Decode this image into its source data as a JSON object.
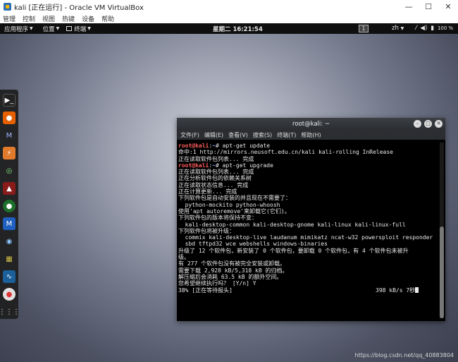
{
  "vbox": {
    "title": "kali [正在运行] - Oracle VM VirtualBox",
    "menu": [
      "管理",
      "控制",
      "视图",
      "热键",
      "设备",
      "帮助"
    ],
    "controls": {
      "minimize": "—",
      "maximize": "☐",
      "close": "✕"
    }
  },
  "topbar": {
    "apps": "应用程序",
    "places": "位置",
    "terminal": "终端",
    "clock": "星期二 16:21:54",
    "workspace": "1",
    "lang": "zh",
    "battery": "100 %"
  },
  "dock": {
    "icons": [
      "terminal-icon",
      "firefox-icon",
      "metasploit-icon",
      "burpsuite-icon",
      "maltego-icon",
      "armitage-icon",
      "faraday-icon",
      "maltego-m-icon",
      "eye-icon",
      "cherrytree-icon",
      "wireshark-icon",
      "chromium-icon",
      "app-grid-icon"
    ]
  },
  "terminal": {
    "title": "root@kali: ~",
    "menu": [
      "文件(F)",
      "编辑(E)",
      "查看(V)",
      "搜索(S)",
      "终端(T)",
      "帮助(H)"
    ],
    "prompt_user": "root@kali",
    "prompt_sep": ":",
    "prompt_path": "~",
    "prompt_hash": "# ",
    "cmd1": "apt-get update",
    "cmd2": "apt-get upgrade",
    "lines_a": [
      "命中:1 http://mirrors.neusoft.edu.cn/kali kali-rolling InRelease",
      "正在读取软件包列表... 完成"
    ],
    "lines_b": [
      "正在读取软件包列表... 完成",
      "正在分析软件包的依赖关系树",
      "正在读取状态信息... 完成",
      "正在计算更新... 完成",
      "下列软件包是自动安装的并且现在不需要了：",
      "  python-mockito python-whoosh",
      "使用'apt autoremove'来卸载它(它们)。",
      "下列软件包的版本将保持不变：",
      "  kali-desktop-common kali-desktop-gnome kali-linux kali-linux-full",
      "下列软件包将被升级：",
      "  commix kali-desktop-live laudanum mimikatz ncat-w32 powersploit responder",
      "  sbd tftpd32 wce webshells windows-binaries",
      "升级了 12 个软件包，新安装了 0 个软件包，要卸载 0 个软件包，有 4 个软件包未被升",
      "级。",
      "有 277 个软件包没有被完全安装或卸载。",
      "需要下载 2,928 kB/5,318 kB 的归档。",
      "解压缩后会消耗 63.5 kB 的额外空间。",
      "您希望继续执行吗？ [Y/n] Y"
    ],
    "progress": "38% [正在等待报头]",
    "rate": "398 kB/s 7秒"
  },
  "watermark": "https://blog.csdn.net/qq_40883804"
}
